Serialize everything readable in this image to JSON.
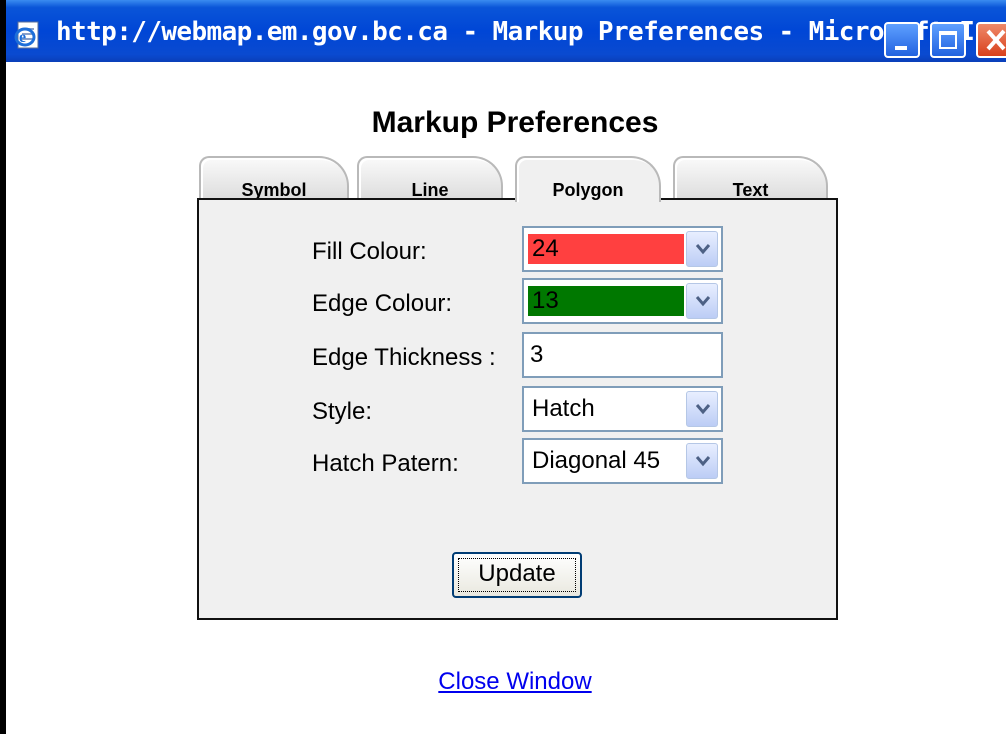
{
  "window": {
    "title": "http://webmap.em.gov.bc.ca - Markup Preferences - Microsoft I...",
    "icon": "ie-page-icon",
    "controls": [
      "minimize-icon",
      "maximize-icon",
      "close-icon"
    ],
    "titlebar_color": "#0046d6"
  },
  "page": {
    "heading": "Markup Preferences",
    "tabs": [
      {
        "label": "Symbol",
        "active": false
      },
      {
        "label": "Line",
        "active": false
      },
      {
        "label": "Polygon",
        "active": true
      },
      {
        "label": "Text",
        "active": false
      }
    ],
    "form": {
      "fill_colour": {
        "label": "Fill Colour:",
        "value": "24",
        "swatch": "#ff4040"
      },
      "edge_colour": {
        "label": "Edge Colour:",
        "value": "13",
        "swatch": "#007800"
      },
      "edge_thickness": {
        "label": "Edge Thickness :",
        "value": "3"
      },
      "style": {
        "label": "Style:",
        "value": "Hatch"
      },
      "hatch_pattern": {
        "label": "Hatch Patern:",
        "value": "Diagonal 45"
      }
    },
    "update_label": "Update",
    "close_link": "Close Window"
  }
}
